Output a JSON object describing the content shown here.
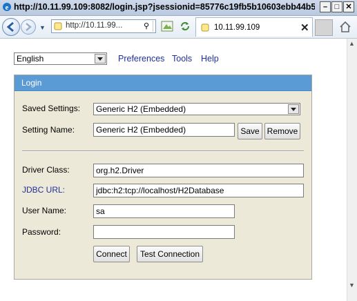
{
  "window": {
    "title": "http://10.11.99.109:8082/login.jsp?jsessionid=85776c19fb5b10603ebb44b5...",
    "minimize": "–",
    "maximize": "□",
    "close": "✕"
  },
  "browser": {
    "address": "http://10.11.99...",
    "tab_label": "10.11.99.109",
    "tab_close": "✕",
    "nav_dropdown": "▼",
    "search_glyph": "⚲"
  },
  "page": {
    "language": "English",
    "links": {
      "preferences": "Preferences",
      "tools": "Tools",
      "help": "Help"
    },
    "panel_title": "Login",
    "labels": {
      "saved_settings": "Saved Settings:",
      "setting_name": "Setting Name:",
      "driver_class": "Driver Class:",
      "jdbc_url": "JDBC URL:",
      "user_name": "User Name:",
      "password": "Password:"
    },
    "values": {
      "saved_settings": "Generic H2 (Embedded)",
      "setting_name": "Generic H2 (Embedded)",
      "driver_class": "org.h2.Driver",
      "jdbc_url": "jdbc:h2:tcp://localhost/H2Database",
      "user_name": "sa",
      "password": ""
    },
    "buttons": {
      "save": "Save",
      "remove": "Remove",
      "connect": "Connect",
      "test_connection": "Test Connection"
    }
  },
  "colors": {
    "panel_header": "#5b9bd5",
    "panel_bg": "#ece9d8",
    "link": "#1f2f9a"
  },
  "icons": [
    "ie-logo-icon",
    "back-icon",
    "forward-icon",
    "page-icon",
    "search-icon",
    "compat-view-icon",
    "refresh-icon",
    "home-icon"
  ]
}
